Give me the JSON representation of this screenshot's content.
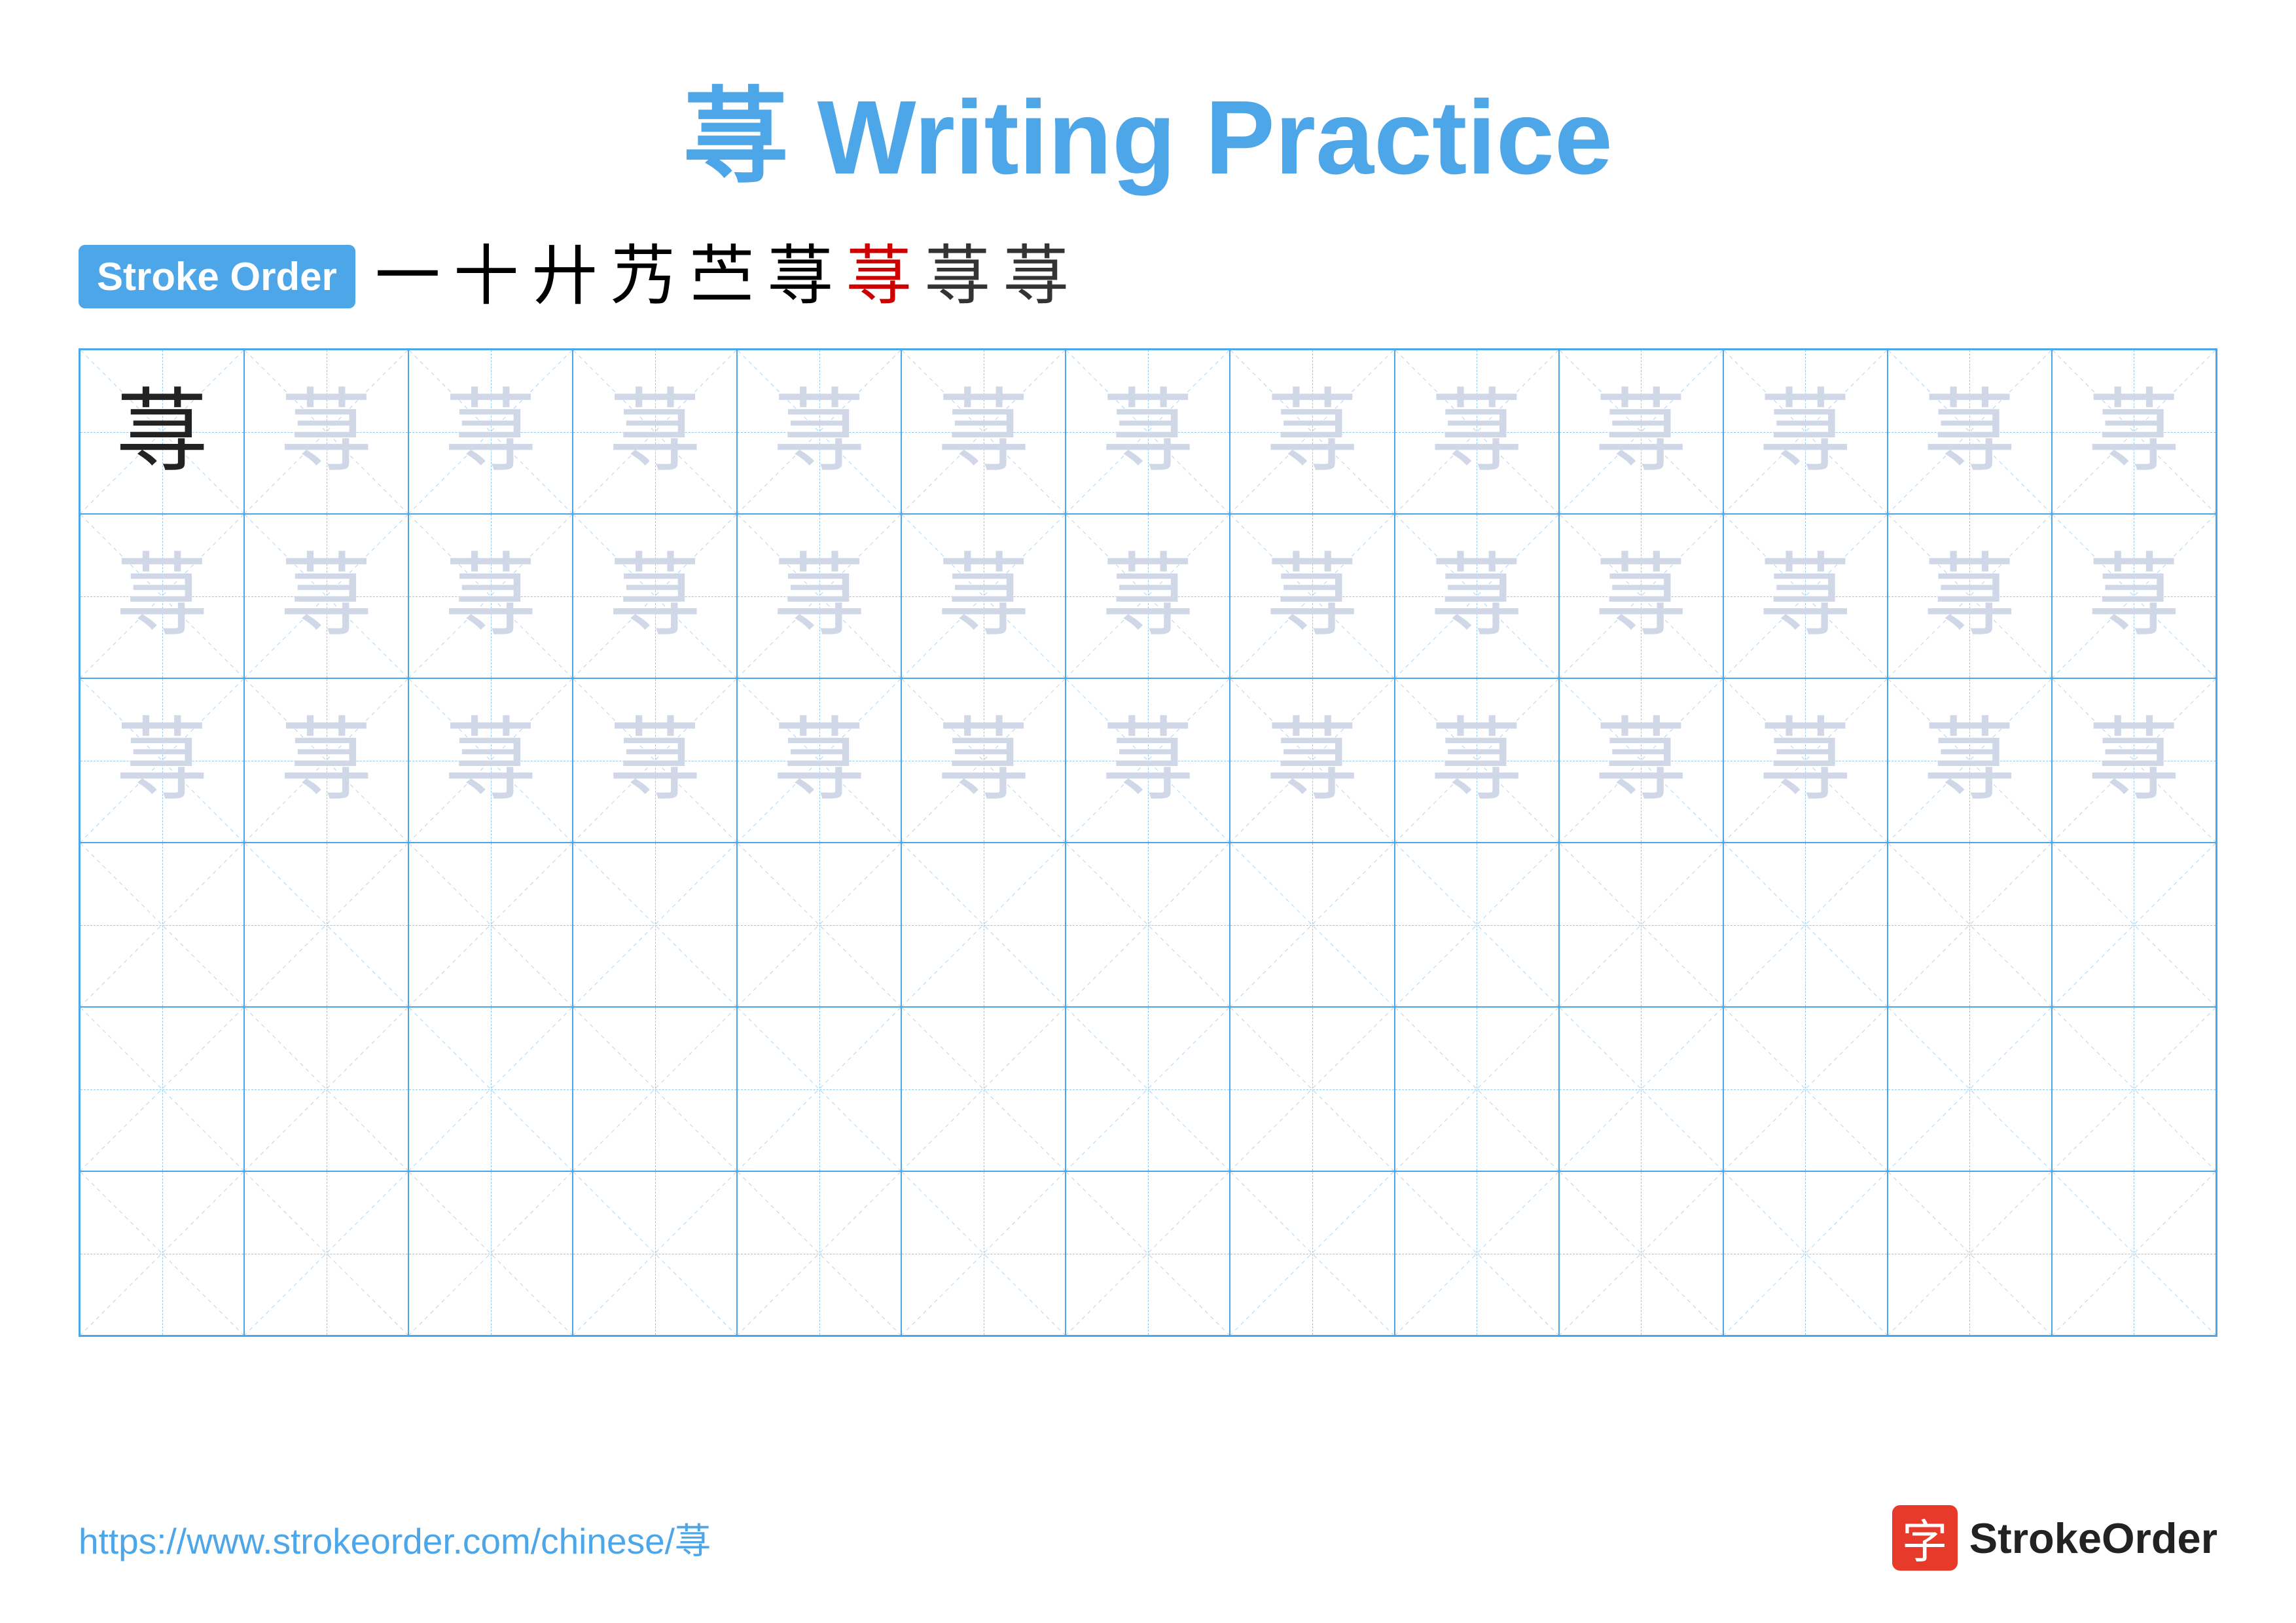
{
  "title": {
    "char": "荨",
    "text": " Writing Practice",
    "full": "荨 Writing Practice"
  },
  "stroke_order": {
    "badge_label": "Stroke Order",
    "strokes": [
      {
        "char": "一",
        "style": "black"
      },
      {
        "char": "十",
        "style": "black"
      },
      {
        "char": "廾",
        "style": "black"
      },
      {
        "char": "艿",
        "style": "black"
      },
      {
        "char": "苎",
        "style": "black"
      },
      {
        "char": "荨",
        "style": "black"
      },
      {
        "char": "荨",
        "style": "red"
      },
      {
        "char": "荨",
        "style": "darkgray"
      },
      {
        "char": "荨",
        "style": "darkgray"
      }
    ]
  },
  "grid": {
    "rows": 6,
    "cols": 13,
    "practice_char": "荨",
    "filled_rows": 3
  },
  "footer": {
    "url": "https://www.strokeorder.com/chinese/荨",
    "logo_text": "StrokeOrder",
    "logo_char": "字"
  }
}
